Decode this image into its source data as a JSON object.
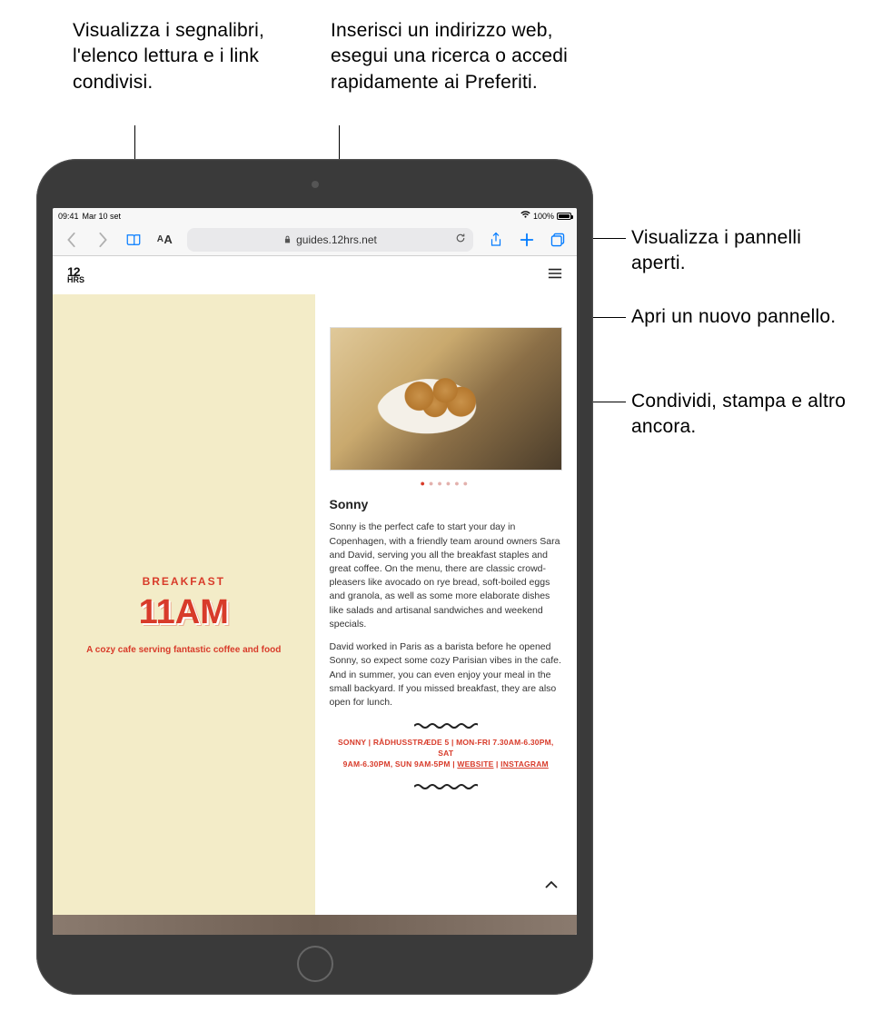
{
  "callouts": {
    "bookmarks": "Visualizza i segnalibri, l'elenco lettura e i link condivisi.",
    "address": "Inserisci un indirizzo web, esegui una ricerca o accedi rapidamente ai Preferiti.",
    "tabs": "Visualizza i pannelli aperti.",
    "newtab": "Apri un nuovo pannello.",
    "share": "Condividi, stampa e altro ancora."
  },
  "status": {
    "time": "09:41",
    "date": "Mar 10 set",
    "battery": "100%"
  },
  "toolbar": {
    "url": "guides.12hrs.net"
  },
  "page": {
    "logo_top": "12",
    "logo_bottom": "HRS",
    "kicker": "BREAKFAST",
    "headline": "11AM",
    "subhead": "A cozy cafe serving fantastic coffee and food",
    "article_title": "Sonny",
    "para1": "Sonny is the perfect cafe to start your day in Copenhagen, with a friendly team around owners Sara and David, serving you all the breakfast staples and great coffee. On the menu, there are classic crowd-pleasers like avocado on rye bread, soft-boiled eggs and granola, as well as some more elaborate dishes like salads and artisanal sandwiches and weekend specials.",
    "para2": "David worked in Paris as a barista before he opened Sonny, so expect some cozy Parisian vibes in the cafe. And in summer, you can even enjoy your meal in the small backyard. If you missed breakfast, they are also open for lunch.",
    "info_line1": "SONNY | RÅDHUSSTRÆDE 5 | MON-FRI 7.30AM-6.30PM, SAT",
    "info_line2_a": "9AM-6.30PM, SUN 9AM-5PM | ",
    "info_link1": "WEBSITE",
    "info_sep": " | ",
    "info_link2": "INSTAGRAM"
  }
}
